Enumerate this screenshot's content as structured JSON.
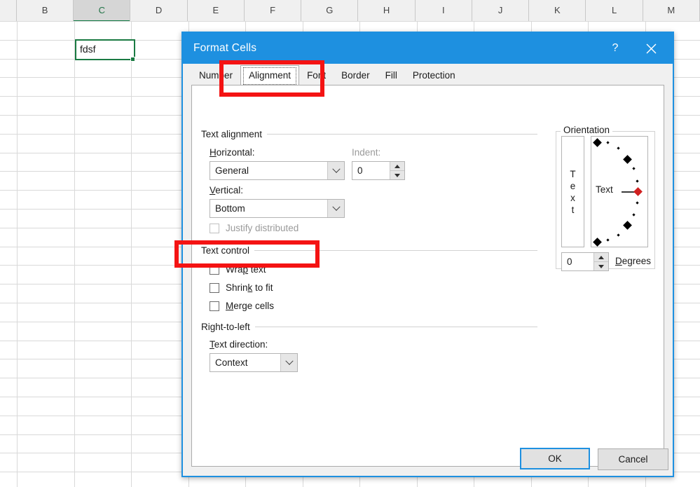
{
  "spreadsheet": {
    "columns": [
      "B",
      "C",
      "D",
      "E",
      "F",
      "G",
      "H",
      "I",
      "J",
      "K",
      "L",
      "M"
    ],
    "selected_column": "C",
    "active_cell_value": "fdsf"
  },
  "dialog": {
    "title": "Format Cells",
    "help_icon": "?",
    "close_icon": "✕",
    "tabs": [
      {
        "label": "Number",
        "active": false
      },
      {
        "label": "Alignment",
        "active": true
      },
      {
        "label": "Font",
        "active": false
      },
      {
        "label": "Border",
        "active": false
      },
      {
        "label": "Fill",
        "active": false
      },
      {
        "label": "Protection",
        "active": false
      }
    ],
    "text_alignment": {
      "group_label": "Text alignment",
      "horizontal_label": "Horizontal:",
      "horizontal_value": "General",
      "vertical_label": "Vertical:",
      "vertical_value": "Bottom",
      "justify_distributed_label": "Justify distributed",
      "justify_distributed_checked": false,
      "indent_label": "Indent:",
      "indent_value": "0"
    },
    "text_control": {
      "group_label": "Text control",
      "wrap_text_label": "Wrap text",
      "wrap_text_checked": false,
      "shrink_to_fit_label": "Shrink to fit",
      "shrink_to_fit_checked": false,
      "merge_cells_label": "Merge cells",
      "merge_cells_checked": false
    },
    "right_to_left": {
      "group_label": "Right-to-left",
      "text_direction_label": "Text direction:",
      "text_direction_value": "Context"
    },
    "orientation": {
      "group_label": "Orientation",
      "vertical_sample_letters": [
        "T",
        "e",
        "x",
        "t"
      ],
      "dial_sample_text": "Text",
      "degrees_value": "0",
      "degrees_label": "Degrees"
    },
    "buttons": {
      "ok_label": "OK",
      "cancel_label": "Cancel"
    }
  },
  "annotations": {
    "highlight_color": "#f41313",
    "boxes": [
      {
        "target": "alignment-tab"
      },
      {
        "target": "shrink-to-fit-row"
      }
    ]
  }
}
